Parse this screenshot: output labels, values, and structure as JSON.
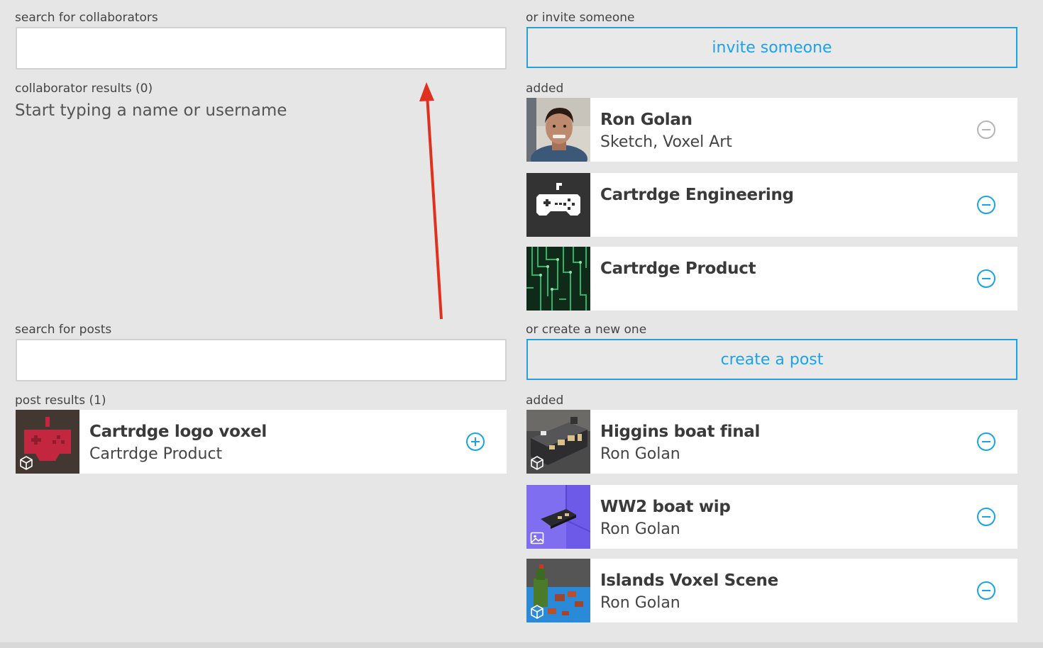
{
  "collaborators": {
    "search_label": "search for collaborators",
    "search_value": "",
    "search_placeholder": "",
    "results_label": "collaborator results (0)",
    "empty_hint": "Start typing a name or username",
    "invite_label": "or invite someone",
    "invite_button": "invite someone",
    "added_label": "added",
    "added": [
      {
        "name": "Ron Golan",
        "subtitle": "Sketch, Voxel Art",
        "icon": "minus-circle-icon",
        "icon_color": "#b5b5b5"
      },
      {
        "name": "Cartrdge Engineering",
        "subtitle": "",
        "icon": "minus-circle-icon",
        "icon_color": "#1aa3e8"
      },
      {
        "name": "Cartrdge Product",
        "subtitle": "",
        "icon": "minus-circle-icon",
        "icon_color": "#1aa3e8"
      }
    ]
  },
  "posts": {
    "search_label": "search for posts",
    "search_value": "",
    "search_placeholder": "",
    "results_label": "post results (1)",
    "results": [
      {
        "title": "Cartrdge logo voxel",
        "subtitle": "Cartrdge Product",
        "icon": "plus-circle-icon",
        "badge": "cube-icon"
      }
    ],
    "create_label": "or create a new one",
    "create_button": "create a post",
    "added_label": "added",
    "added": [
      {
        "title": "Higgins boat final",
        "subtitle": "Ron Golan",
        "icon": "minus-circle-icon",
        "badge": "cube-icon"
      },
      {
        "title": "WW2 boat wip",
        "subtitle": "Ron Golan",
        "icon": "minus-circle-icon",
        "badge": "image-icon"
      },
      {
        "title": "Islands Voxel Scene",
        "subtitle": "Ron Golan",
        "icon": "minus-circle-icon",
        "badge": "cube-icon"
      }
    ]
  },
  "colors": {
    "accent": "#1aa3e8",
    "background": "#e6e6e6",
    "arrow": "#e0301e"
  }
}
